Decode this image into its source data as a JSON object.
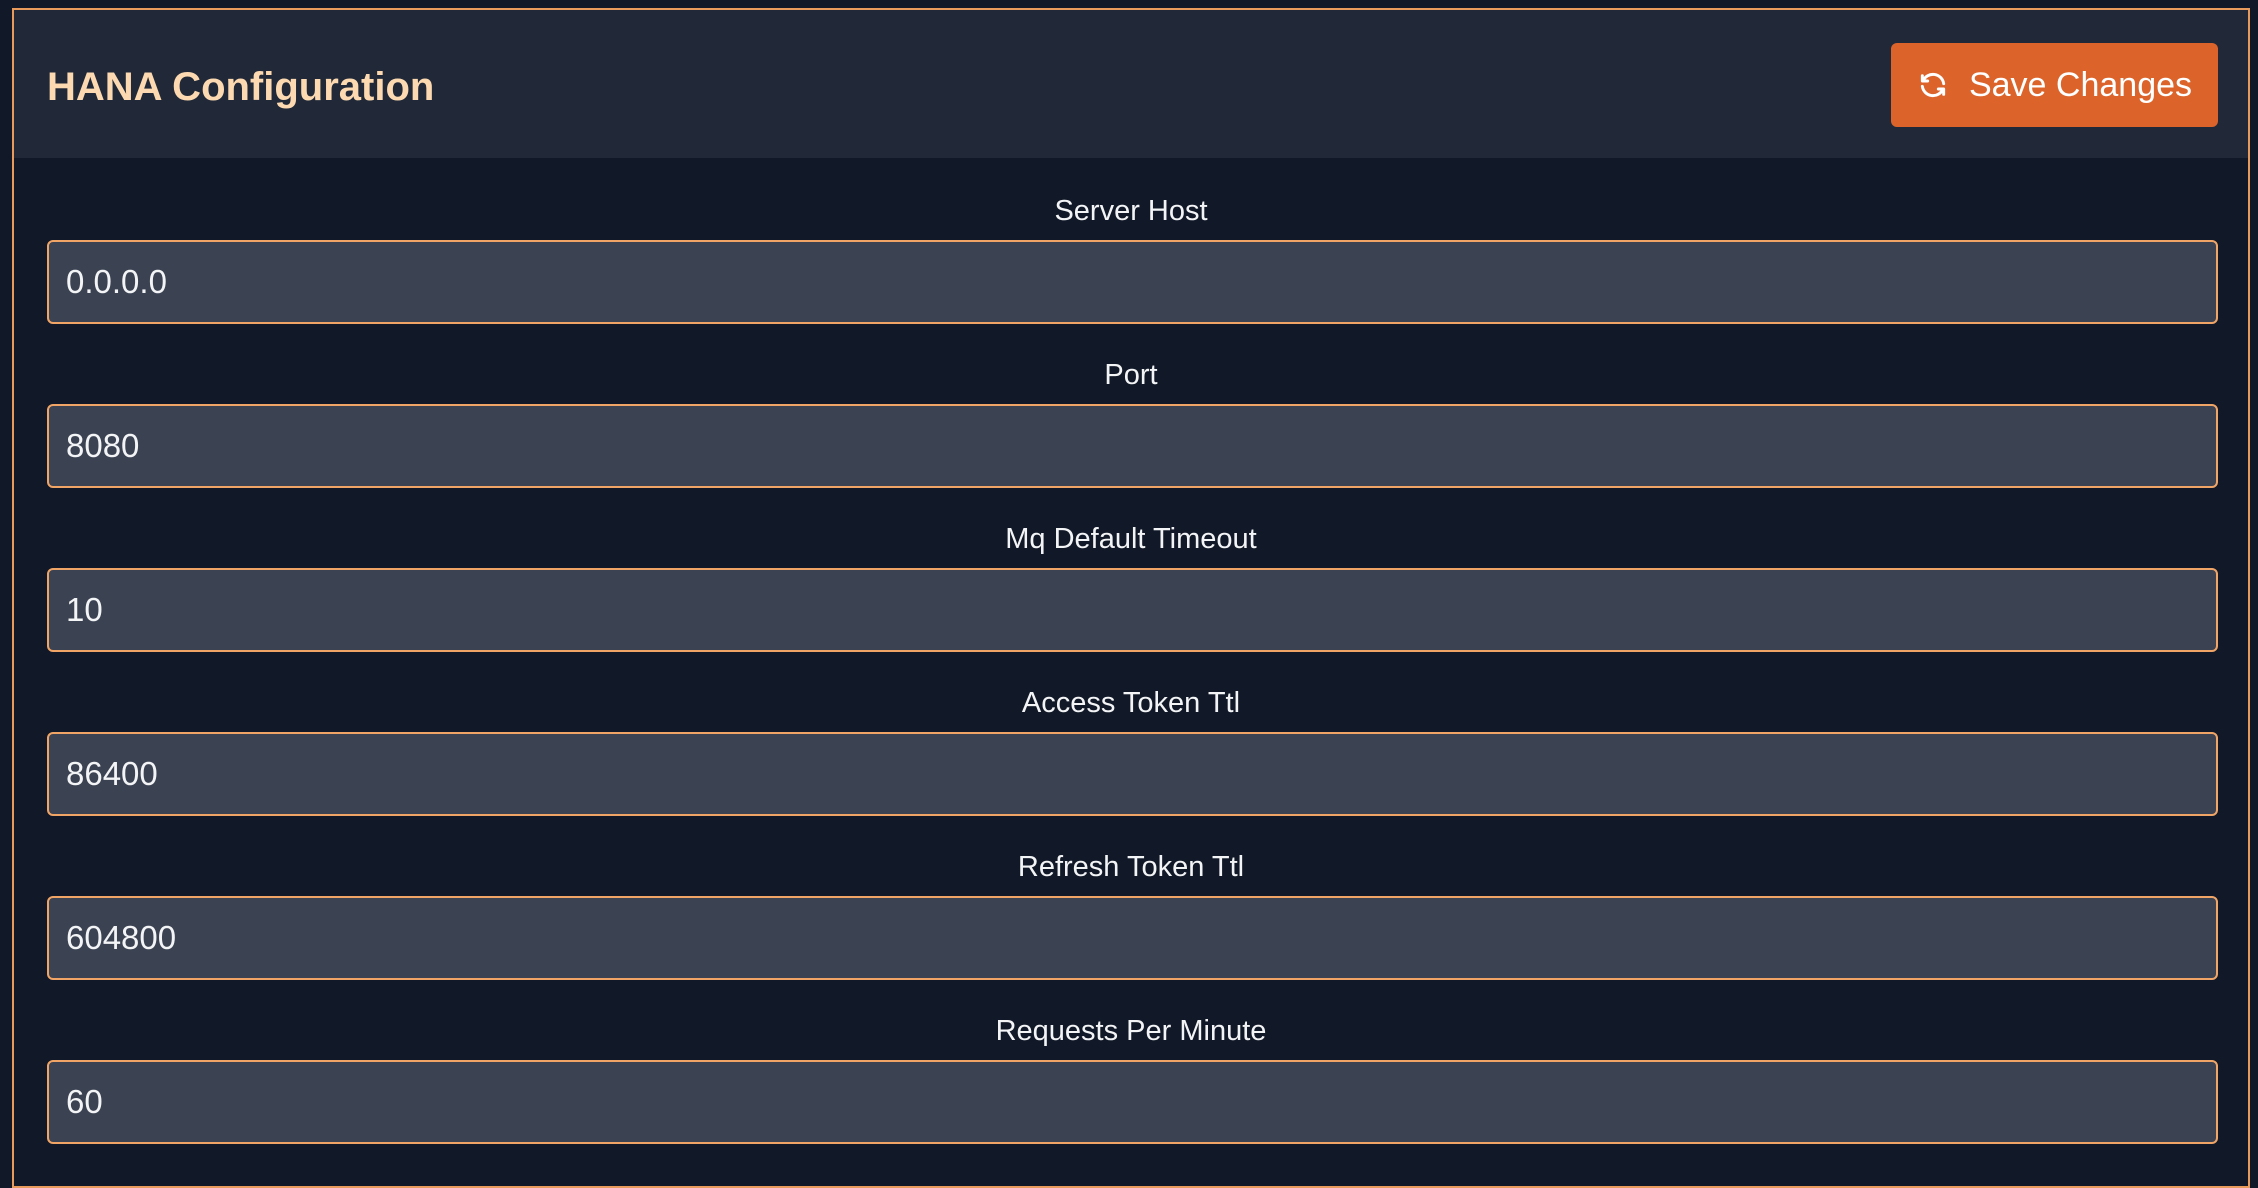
{
  "header": {
    "title": "HANA Configuration",
    "save_label": "Save Changes",
    "save_icon": "refresh-icon"
  },
  "fields": [
    {
      "label": "Server Host",
      "value": "0.0.0.0"
    },
    {
      "label": "Port",
      "value": "8080"
    },
    {
      "label": "Mq Default Timeout",
      "value": "10"
    },
    {
      "label": "Access Token Ttl",
      "value": "86400"
    },
    {
      "label": "Refresh Token Ttl",
      "value": "604800"
    },
    {
      "label": "Requests Per Minute",
      "value": "60"
    }
  ],
  "colors": {
    "accent": "#dc642b",
    "input_border": "#f0a566",
    "title": "#fcd9b1",
    "background": "#111827",
    "header_bg": "#212938",
    "input_bg": "#3b4252"
  }
}
